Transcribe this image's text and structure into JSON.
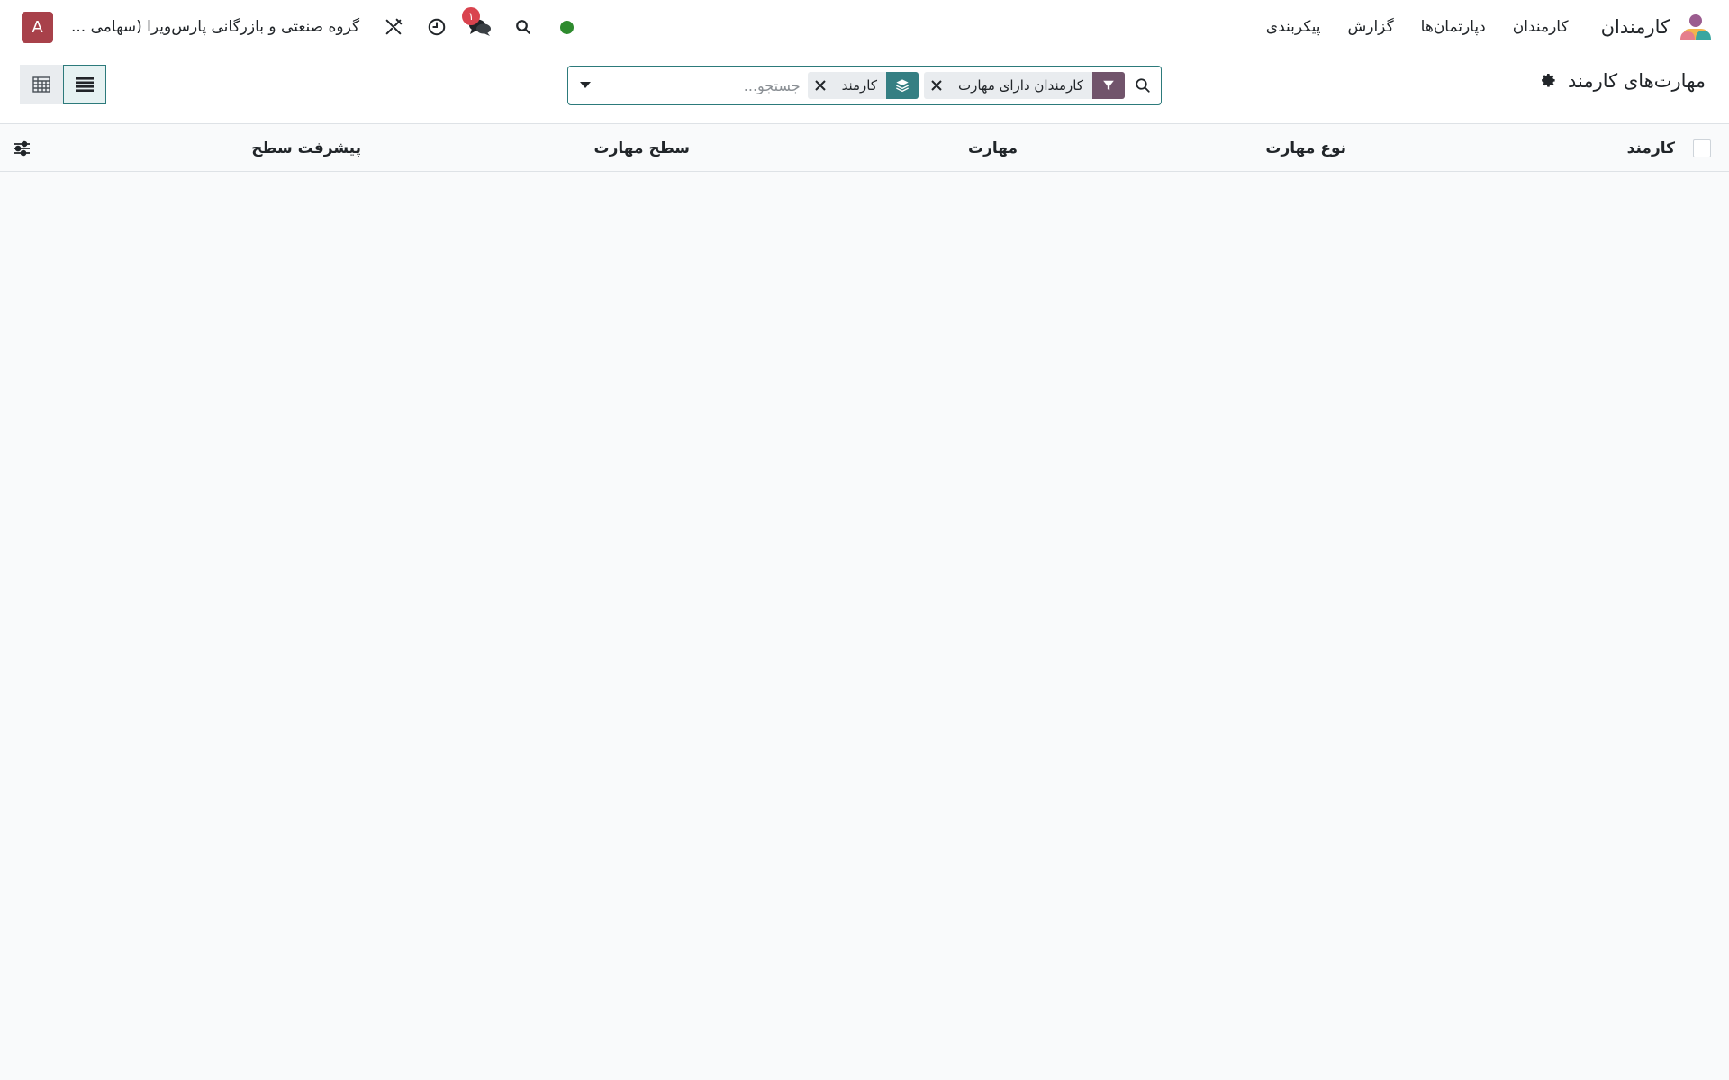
{
  "navbar": {
    "app_title": "کارمندان",
    "menu": [
      {
        "label": "کارمندان"
      },
      {
        "label": "دپارتمان‌ها"
      },
      {
        "label": "گزارش"
      },
      {
        "label": "پیکربندی"
      }
    ],
    "messages_badge": "۱",
    "company": "گروه صنعتی و بازرگانی پارس‌ویرا (سهامی ...",
    "avatar_initial": "A",
    "icons": [
      "presence-dot",
      "search-icon",
      "chat-icon",
      "clock-icon",
      "tools-icon"
    ]
  },
  "control_panel": {
    "title": "مهارت‌های کارمند",
    "search": {
      "placeholder": "جستجو...",
      "facets": [
        {
          "type": "filter",
          "label": "کارمندان دارای مهارت"
        },
        {
          "type": "group",
          "label": "کارمند"
        }
      ]
    },
    "views": [
      "list",
      "pivot"
    ],
    "active_view": "list"
  },
  "list": {
    "columns": [
      "کارمند",
      "نوع مهارت",
      "مهارت",
      "سطح مهارت",
      "پیشرفت سطح"
    ],
    "rows": []
  },
  "colors": {
    "primary": "#71546b",
    "accent": "#2c7a7b",
    "badge": "#d9434e",
    "avatar": "#a8414a",
    "presence": "#2e8b2e"
  }
}
